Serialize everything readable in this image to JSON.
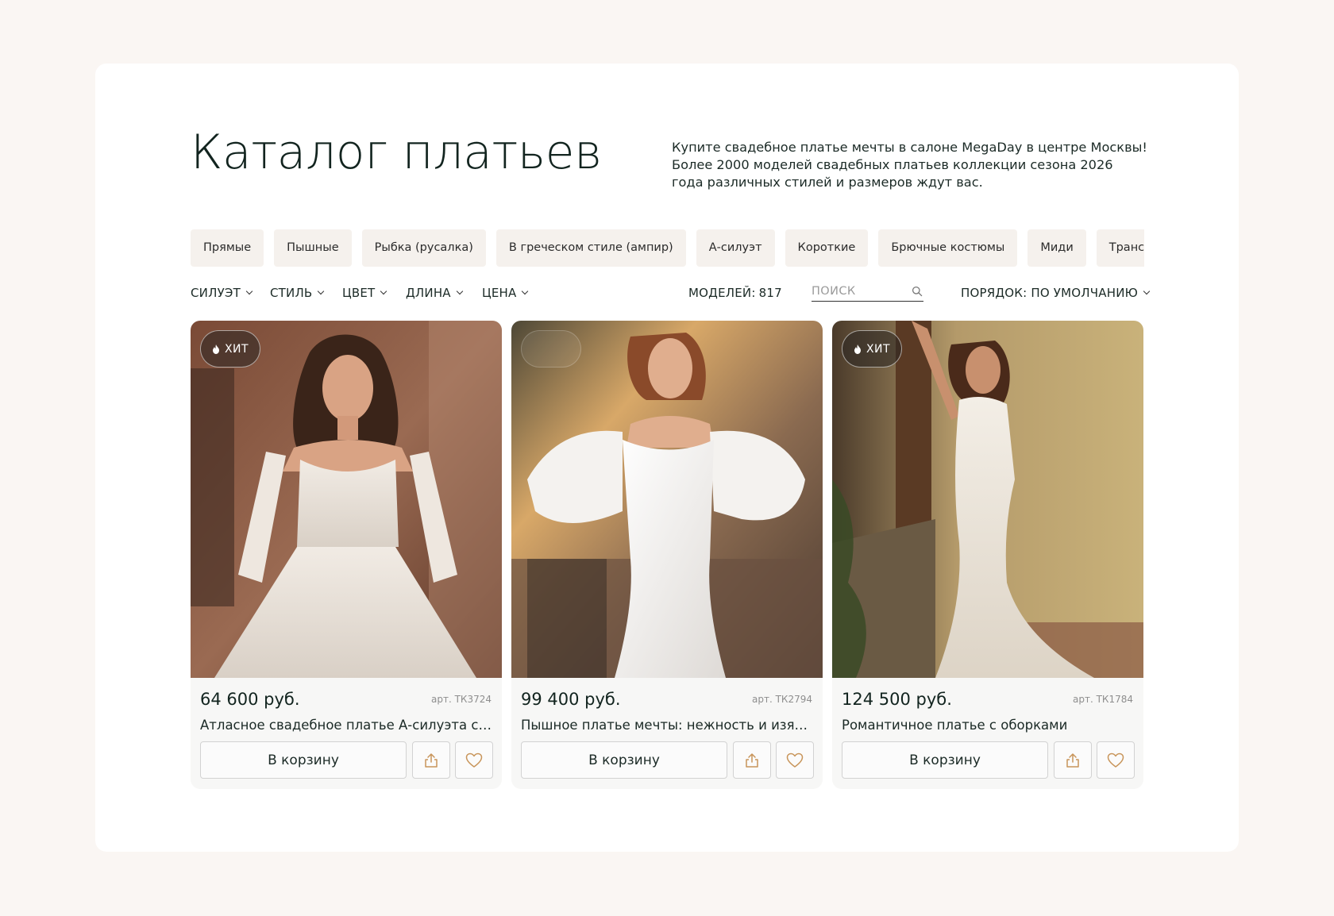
{
  "header": {
    "title": "Каталог платьев",
    "intro": "Купите свадебное платье мечты в салоне MegaDay в центре Москвы! Более 2000 моделей свадебных платьев коллекции сезона 2026 года различных стилей и размеров ждут вас."
  },
  "chips": [
    "Прямые",
    "Пышные",
    "Рыбка (русалка)",
    "В греческом стиле (ампир)",
    "А-силуэт",
    "Короткие",
    "Брючные костюмы",
    "Миди",
    "Трансформеры"
  ],
  "filters": {
    "silhouette": "СИЛУЭТ",
    "style": "СТИЛЬ",
    "color": "ЦВЕТ",
    "length": "ДЛИНА",
    "price": "ЦЕНА"
  },
  "count": {
    "label": "МОДЕЛЕЙ:",
    "value": "817"
  },
  "search": {
    "placeholder": "ПОИСК",
    "value": ""
  },
  "sort": {
    "label": "ПОРЯДОК: ПО УМОЛЧАНИЮ"
  },
  "colors": {
    "accent": "#c8955a",
    "title": "#12241f",
    "chip_bg": "#f5f1ed",
    "page_bg": "#faf6f3"
  },
  "products": [
    {
      "badge": "ХИТ",
      "price": "64 600 руб.",
      "article": "арт. ТК3724",
      "name": "Атласное свадебное платье А-силуэта с кружевом",
      "cart_label": "В корзину"
    },
    {
      "badge": "",
      "price": "99 400 руб.",
      "article": "арт. ТК2794",
      "name": "Пышное платье мечты: нежность и изящность",
      "cart_label": "В корзину"
    },
    {
      "badge": "ХИТ",
      "price": "124 500 руб.",
      "article": "арт. ТК1784",
      "name": "Романтичное платье с оборками",
      "cart_label": "В корзину"
    }
  ]
}
